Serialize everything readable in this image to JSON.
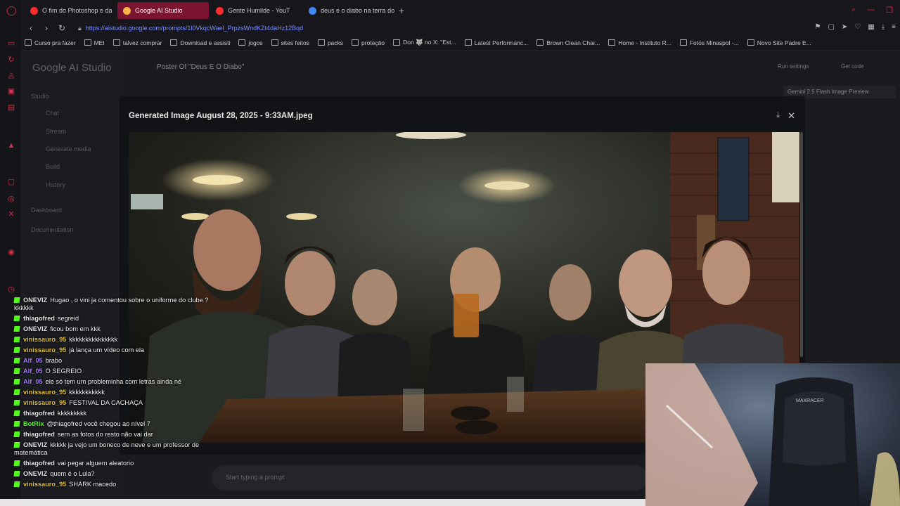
{
  "browser": {
    "tabs": [
      {
        "label": "O fim do Photoshop e da",
        "color": "#ff2e2e"
      },
      {
        "label": "Google AI Studio",
        "color": "#d5304b",
        "active": true
      },
      {
        "label": "Gente Humilde - YouT",
        "color": "#ff2e2e"
      },
      {
        "label": "deus e o diabo na terra do",
        "color": "#4285f4"
      }
    ],
    "url": "https://aistudio.google.com/prompts/1l0VkqcWael_PrpzsWndKZt4daHz12Bqd",
    "bookmarks": [
      "Curso pra fazer",
      "MEI",
      "talvez comprar",
      "Download e assisti",
      "jogos",
      "sites feitos",
      "packs",
      "proteção",
      "Don 🐺 no X: \"Est...",
      "Latest Performanc...",
      "Brown Clean Char...",
      "Home - Instituto R...",
      "Fotos Minaspol -...",
      "Novo Site Padre E..."
    ]
  },
  "studio": {
    "logo": "Google AI Studio",
    "prompt_title": "Poster Of \"Deus E O Diabo\"",
    "sidebar": [
      "Studio",
      "Chat",
      "Stream",
      "Generate media",
      "Build",
      "History",
      "Dashboard",
      "Documentation"
    ],
    "run_settings": "Run settings",
    "get_code": "Get code",
    "model": "Gemini 2.5 Flash Image Preview",
    "prompt_placeholder": "Start typing a prompt"
  },
  "modal": {
    "title": "Generated Image August 28, 2025 - 9:33AM.jpeg"
  },
  "chat": {
    "messages": [
      {
        "user": "ONEVIZ",
        "text": "Hugao , o vini ja comentou sobre o uniforme do clube ? kkkkkk",
        "color": "#e6e6e6",
        "wrap": true
      },
      {
        "user": "thiagofred",
        "text": "segreid",
        "color": "#e6e6e6"
      },
      {
        "user": "ONEVIZ",
        "text": "ficou bom em kkk",
        "color": "#e6e6e6"
      },
      {
        "user": "vinissauro_95",
        "text": "kkkkkkkkkkkkkkk",
        "color": "#e0c026"
      },
      {
        "user": "vinissauro_95",
        "text": "já lança um vídeo com ela",
        "color": "#e0c026"
      },
      {
        "user": "Alf_05",
        "text": "brabo",
        "color": "#a47aff"
      },
      {
        "user": "Alf_05",
        "text": "O SEGREIO",
        "color": "#a47aff"
      },
      {
        "user": "Alf_05",
        "text": "ele só tem um probleminha com letras ainda né",
        "color": "#a47aff"
      },
      {
        "user": "vinissauro_95",
        "text": "kkkkkkkkkkk",
        "color": "#e0c026"
      },
      {
        "user": "vinissauro_95",
        "text": "FESTIVAL DA CACHAÇA",
        "color": "#e0c026"
      },
      {
        "user": "thiagofred",
        "text": "kkkkkkkkk",
        "color": "#e6e6e6"
      },
      {
        "user": "BotRix",
        "text": "@thiagofred você chegou ao nível 7",
        "color": "#53fc18"
      },
      {
        "user": "thiagofred",
        "text": "sem as fotos do resto não vai dar",
        "color": "#e6e6e6"
      },
      {
        "user": "ONEVIZ",
        "text": "kkkkk ja vejo um boneco de neve e um professor de matemática",
        "color": "#e6e6e6",
        "wrap": true
      },
      {
        "user": "thiagofred",
        "text": "vai pegar alguem aleatorio",
        "color": "#e6e6e6"
      },
      {
        "user": "ONEVIZ",
        "text": "quem é o Lula?",
        "color": "#e6e6e6"
      },
      {
        "user": "vinissauro_95",
        "text": "SHARK macedo",
        "color": "#e0c026"
      }
    ]
  },
  "webcam": {
    "chair_text": "MAXRACER"
  }
}
